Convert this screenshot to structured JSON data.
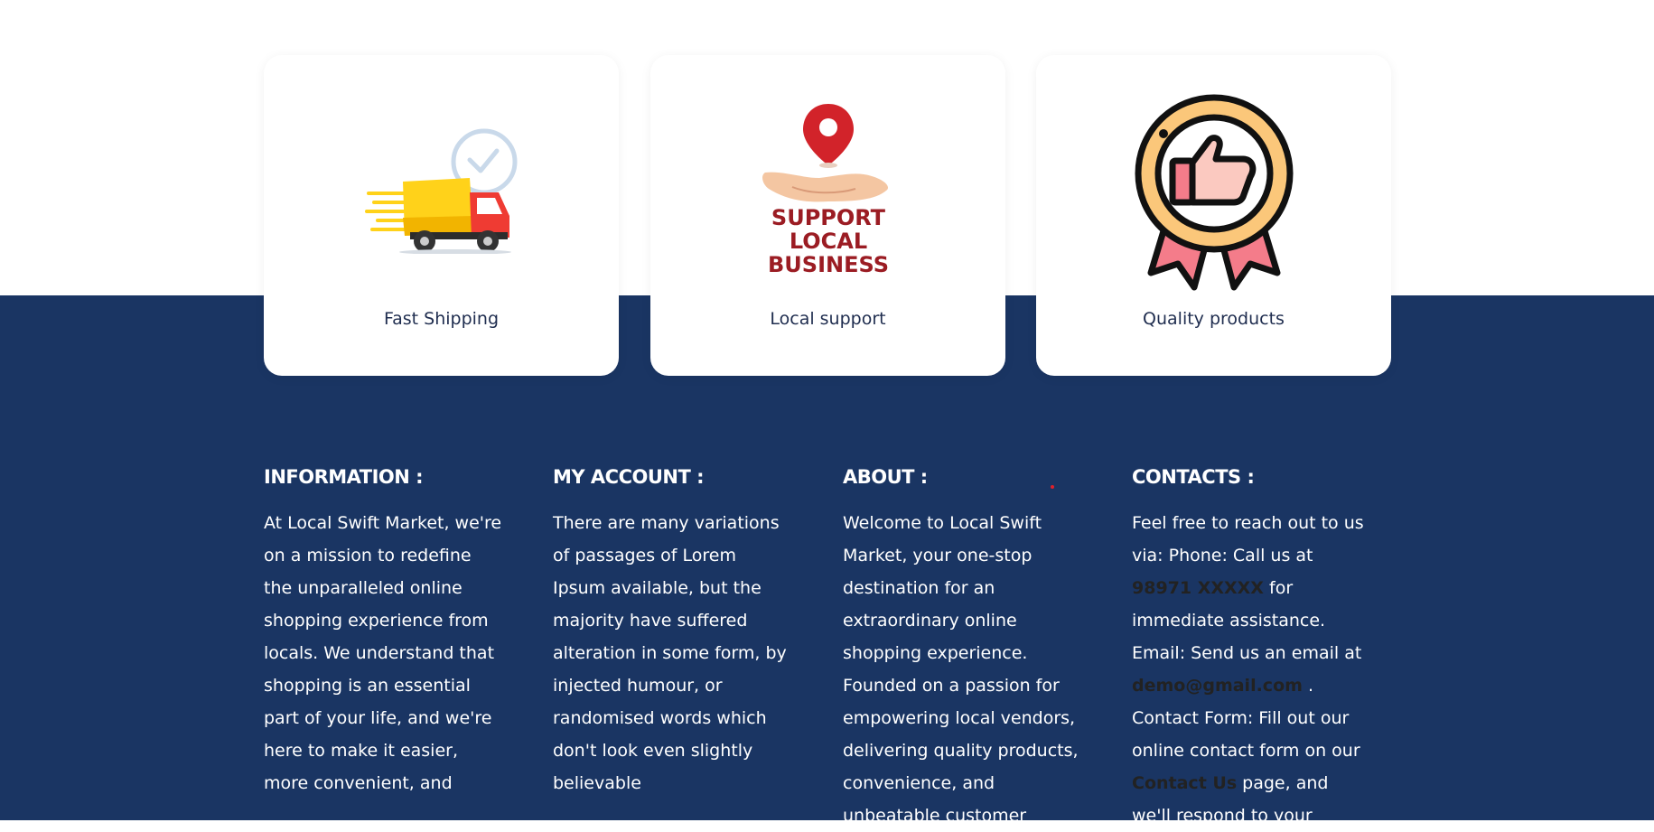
{
  "features": [
    {
      "label": "Fast Shipping",
      "icon": "delivery-truck-icon"
    },
    {
      "label": "Local support",
      "icon": "support-local-business-icon"
    },
    {
      "label": "Quality products",
      "icon": "quality-badge-icon"
    }
  ],
  "support_art_text": [
    "SUPPORT",
    "LOCAL",
    "BUSINESS"
  ],
  "footer": {
    "information": {
      "title": "INFORMATION :",
      "text": "At Local Swift Market, we're on a mission to redefine the unparalleled online shopping experience from locals. We understand that shopping is an essential part of your life, and we're here to make it easier, more convenient, and"
    },
    "account": {
      "title": "MY ACCOUNT :",
      "text": "There are many variations of passages of Lorem Ipsum available, but the majority have suffered alteration in some form, by injected humour, or randomised words which don't look even slightly believable"
    },
    "about": {
      "title": "ABOUT :",
      "text": "Welcome to Local Swift Market, your one-stop destination for an extraordinary online shopping experience. Founded on a passion for empowering local vendors, delivering quality products, convenience, and unbeatable customer"
    },
    "contacts": {
      "title": "CONTACTS :",
      "part1": "Feel free to reach out to us via: Phone: Call us at ",
      "phone": "98971 XXXXX",
      "part2": " for immediate assistance. Email: Send us an email at ",
      "email": "demo@gmail.com",
      "part3": " . Contact Form: Fill out our online contact form on our ",
      "contact_link": "Contact Us",
      "part4": " page, and we'll respond to your"
    }
  },
  "colors": {
    "footer_bg": "#1a3563",
    "card_text": "#1f2d4f",
    "accent_red": "#e0202a",
    "badge_gold": "#fbc77a",
    "badge_ribbon": "#f47c8a"
  }
}
